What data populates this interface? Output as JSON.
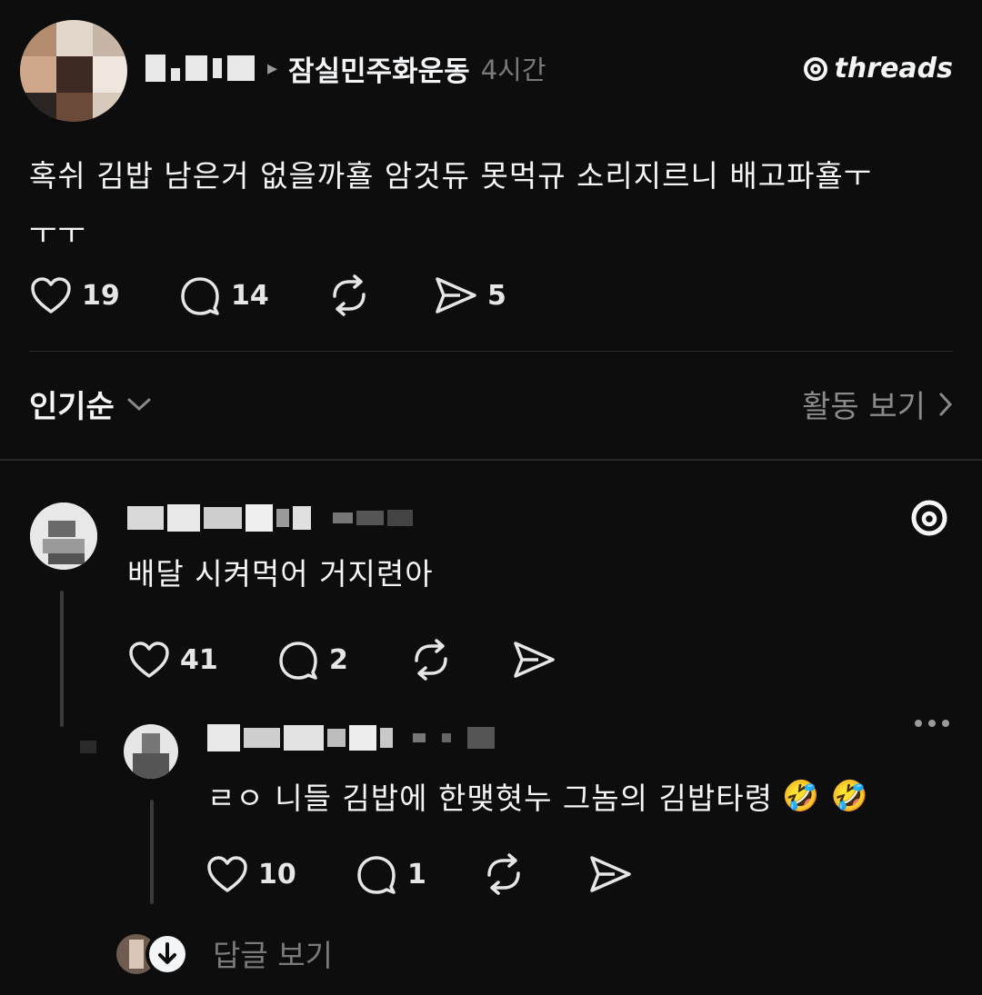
{
  "post": {
    "topic": "잠실민주화운동",
    "time": "4시간",
    "brand": "threads",
    "text_line1": "혹쉬 김밥 남은거 없을까횰 암것듀 못먹규 소리지르니 배고파횰ㅜ",
    "text_line2": "ㅜㅜ",
    "likes": "19",
    "comments": "14",
    "shares": "5"
  },
  "sort": {
    "label": "인기순",
    "activity_label": "활동 보기"
  },
  "comments": [
    {
      "text": "배달 시켜먹어 거지련아",
      "likes": "41",
      "comments": "2"
    },
    {
      "text": "ㄹㅇ 니들 김밥에 한맺혓누 그놈의 김밥타령",
      "emoji": "🤣 🤣",
      "likes": "10",
      "comments": "1"
    }
  ],
  "replies": {
    "view_label": "답글 보기"
  },
  "icons": [
    "heart-icon",
    "comment-icon",
    "repost-icon",
    "share-icon",
    "chevron-down-icon",
    "chevron-right-icon",
    "threads-logo-icon",
    "more-icon",
    "arrow-down-icon"
  ]
}
